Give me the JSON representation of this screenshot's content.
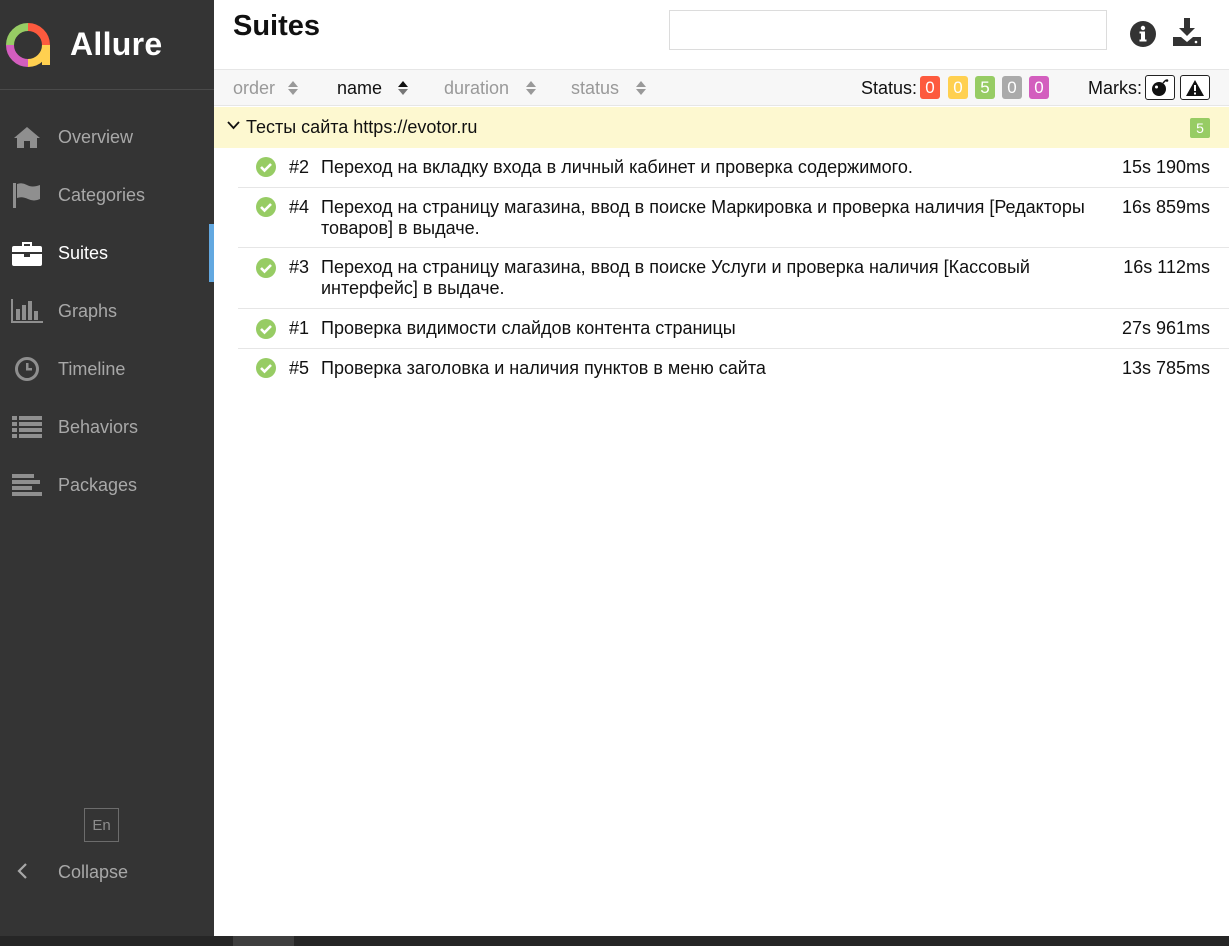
{
  "app": {
    "name": "Allure"
  },
  "sidebar": {
    "items": [
      {
        "label": "Overview",
        "icon": "home-icon"
      },
      {
        "label": "Categories",
        "icon": "flag-icon"
      },
      {
        "label": "Suites",
        "icon": "briefcase-icon",
        "active": true
      },
      {
        "label": "Graphs",
        "icon": "bar-chart-icon"
      },
      {
        "label": "Timeline",
        "icon": "clock-icon"
      },
      {
        "label": "Behaviors",
        "icon": "list-icon"
      },
      {
        "label": "Packages",
        "icon": "align-left-icon"
      }
    ],
    "language": "En",
    "collapse_label": "Collapse"
  },
  "header": {
    "title": "Suites",
    "search": {
      "value": "",
      "placeholder": ""
    }
  },
  "toolbar": {
    "sort": [
      {
        "label": "order",
        "active": false
      },
      {
        "label": "name",
        "active": true
      },
      {
        "label": "duration",
        "active": false
      },
      {
        "label": "status",
        "active": false
      }
    ],
    "status_label": "Status:",
    "status_counts": [
      {
        "status": "failed",
        "value": "0",
        "color": "#fd5a3e"
      },
      {
        "status": "broken",
        "value": "0",
        "color": "#ffd050"
      },
      {
        "status": "passed",
        "value": "5",
        "color": "#97cc64"
      },
      {
        "status": "skipped",
        "value": "0",
        "color": "#aaaaaa"
      },
      {
        "status": "unknown",
        "value": "0",
        "color": "#d35ebe"
      }
    ],
    "marks_label": "Marks:"
  },
  "group": {
    "name": "Тесты сайта https://evotor.ru",
    "count": "5"
  },
  "tests": [
    {
      "num": "#2",
      "name": "Переход на вкладку входа в личный кабинет и проверка содержимого.",
      "duration": "15s 190ms"
    },
    {
      "num": "#4",
      "name": "Переход на страницу магазина, ввод в поиске Маркировка и проверка наличия [Редакторы товаров] в выдаче.",
      "duration": "16s 859ms"
    },
    {
      "num": "#3",
      "name": "Переход на страницу магазина, ввод в поиске Услуги и проверка наличия [Кассовый интерфейс] в выдаче.",
      "duration": "16s 112ms"
    },
    {
      "num": "#1",
      "name": "Проверка видимости слайдов контента страницы",
      "duration": "27s 961ms"
    },
    {
      "num": "#5",
      "name": "Проверка заголовка и наличия пунктов в меню сайта",
      "duration": "13s 785ms"
    }
  ]
}
